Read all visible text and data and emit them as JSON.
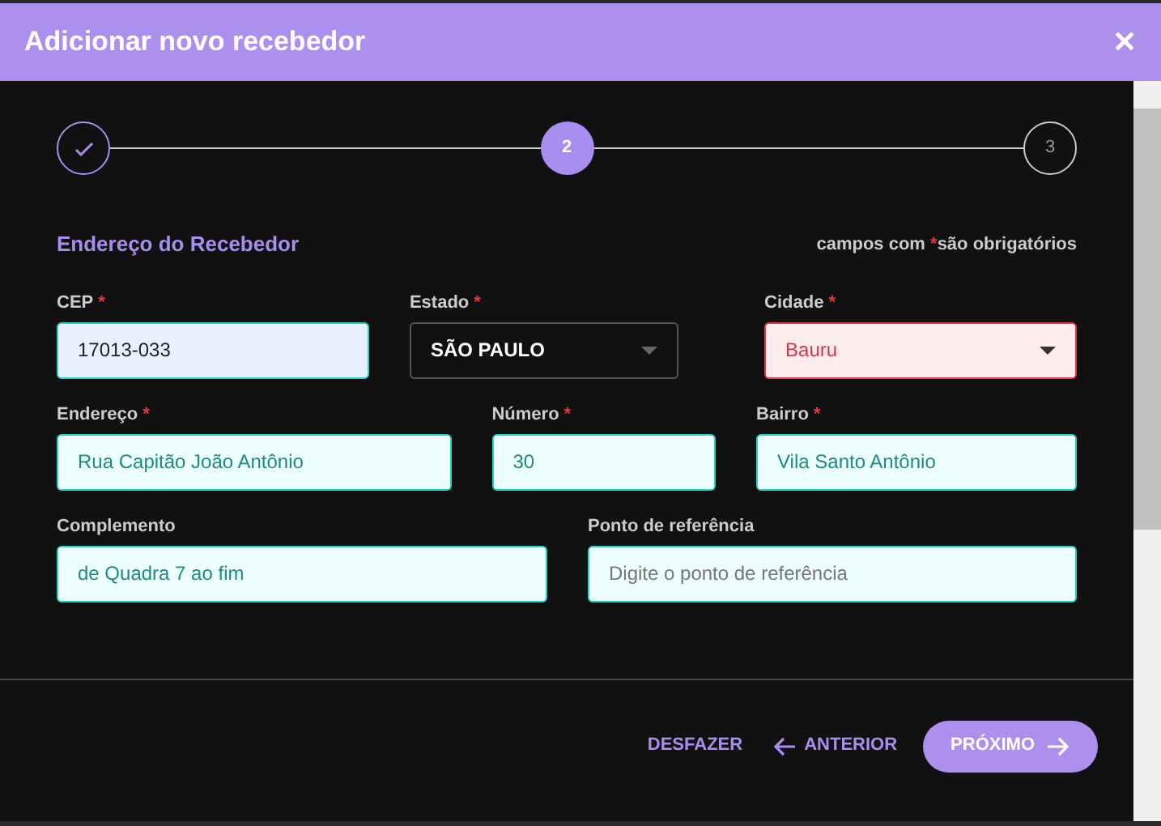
{
  "dialog": {
    "title": "Adicionar novo recebedor",
    "close_label": "✕"
  },
  "steps": [
    {
      "completed": true,
      "selected": false
    },
    {
      "label": "2",
      "completed": false,
      "selected": true
    },
    {
      "label": "3",
      "completed": false,
      "selected": false
    }
  ],
  "section": {
    "title": "Endereço do Recebedor",
    "note_before": "campos com",
    "note_mark": "*",
    "note_after": "são obrigatórios"
  },
  "rows": [
    [
      {
        "label": "CEP",
        "required": true,
        "kind": "text",
        "value": "17013-033",
        "autofilled": true,
        "error": false,
        "disabled": false
      },
      {
        "label": "Estado",
        "required": true,
        "kind": "select",
        "value": "SÃO PAULO",
        "autofilled": false,
        "error": false,
        "disabled": true
      },
      {
        "label": "Cidade",
        "required": true,
        "kind": "select",
        "value": "Bauru",
        "autofilled": false,
        "error": true,
        "disabled": false
      }
    ],
    [
      {
        "label": "Endereço",
        "required": true,
        "kind": "text",
        "value": "Rua Capitão João Antônio",
        "autofilled": false,
        "error": false,
        "disabled": false
      },
      {
        "label": "Número",
        "required": true,
        "kind": "text",
        "value": "30",
        "autofilled": false,
        "error": false,
        "disabled": false
      },
      {
        "label": "Bairro",
        "required": true,
        "kind": "text",
        "value": "Vila Santo Antônio",
        "autofilled": false,
        "error": false,
        "disabled": false
      }
    ],
    [
      {
        "label": "Complemento",
        "required": false,
        "kind": "text",
        "value": "de Quadra 7 ao fim",
        "autofilled": false,
        "error": false,
        "disabled": false
      },
      {
        "label": "Ponto de referência",
        "required": false,
        "kind": "text",
        "placeholder": "Digite o ponto de referência",
        "autofilled": false,
        "error": false,
        "disabled": false
      }
    ]
  ],
  "buttons": [
    {
      "label": "DESFAZER",
      "kind": "text"
    },
    {
      "label": "ANTERIOR",
      "kind": "back"
    },
    {
      "label": "PRÓXIMO",
      "kind": "primary"
    }
  ]
}
